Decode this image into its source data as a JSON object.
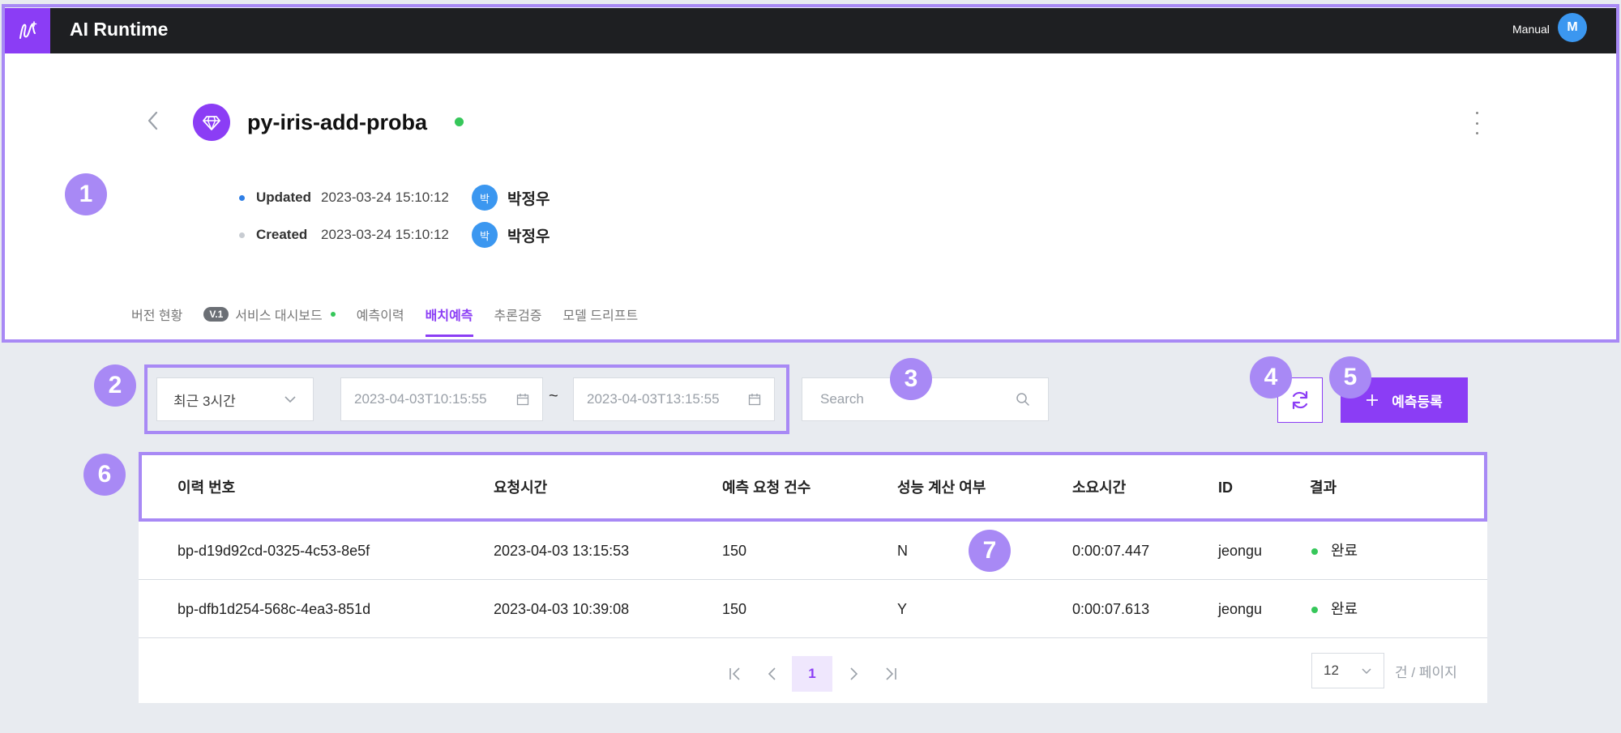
{
  "app": {
    "title": "AI Runtime",
    "user_mode": "Manual",
    "user_initial": "M"
  },
  "model": {
    "name": "py-iris-add-proba",
    "status_color": "#36c75a",
    "updated": {
      "label": "Updated",
      "date": "2023-03-24 15:10:12",
      "avatar_char": "박",
      "user": "박정우"
    },
    "created": {
      "label": "Created",
      "date": "2023-03-24 15:10:12",
      "avatar_char": "박",
      "user": "박정우"
    }
  },
  "tabs": [
    {
      "label": "버전 현황"
    },
    {
      "label": "서비스 대시보드",
      "badge": "V.1"
    },
    {
      "label": "예측이력"
    },
    {
      "label": "배치예측",
      "active": true
    },
    {
      "label": "추론검증"
    },
    {
      "label": "모델 드리프트"
    }
  ],
  "filters": {
    "range": "최근 3시간",
    "start": "2023-04-03T10:15:55",
    "tilde": "~",
    "end": "2023-04-03T13:15:55",
    "search_placeholder": "Search"
  },
  "actions": {
    "register_label": "예측등록",
    "register_icon": "plus-icon",
    "refresh_icon": "refresh-icon"
  },
  "table": {
    "headers": [
      "이력 번호",
      "요청시간",
      "예측 요청 건수",
      "성능 계산 여부",
      "소요시간",
      "ID",
      "결과"
    ],
    "rows": [
      [
        "bp-d19d92cd-0325-4c53-8e5f",
        "2023-04-03 13:15:53",
        "150",
        "N",
        "0:00:07.447",
        "jeongu",
        "완료"
      ],
      [
        "bp-dfb1d254-568c-4ea3-851d",
        "2023-04-03 10:39:08",
        "150",
        "Y",
        "0:00:07.613",
        "jeongu",
        "완료"
      ]
    ]
  },
  "pagination": {
    "current": "1",
    "per_page": "12",
    "per_page_label": "건 / 페이지"
  },
  "callouts": [
    "1",
    "2",
    "3",
    "4",
    "5",
    "6",
    "7"
  ],
  "colors": {
    "accent": "#8b3df5",
    "callout": "#a889f5",
    "topbar": "#1e1f22",
    "success": "#36c75a",
    "avatar": "#3b97f0"
  }
}
